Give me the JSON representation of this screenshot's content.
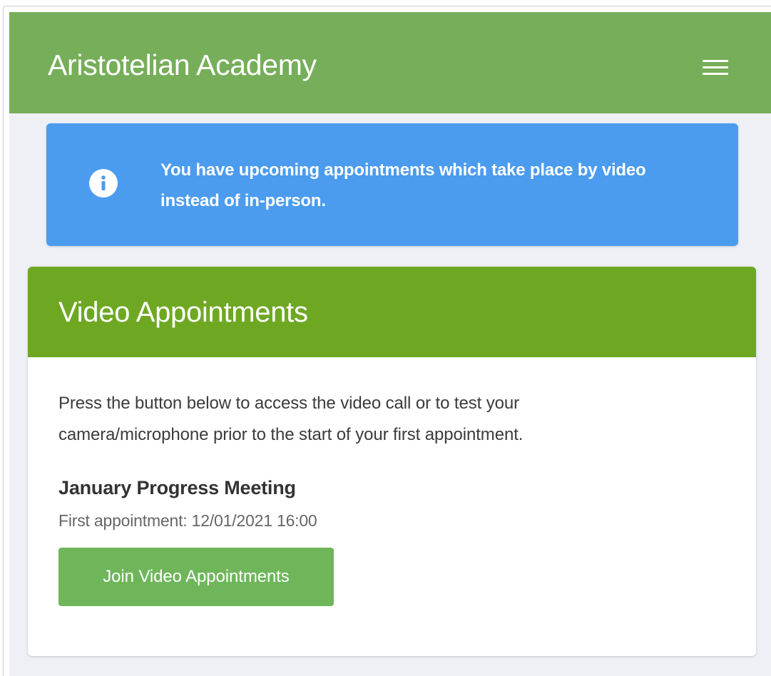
{
  "header": {
    "brand": "Aristotelian Academy",
    "menu_icon": "hamburger-menu-icon",
    "color": "#76ae59"
  },
  "alert": {
    "icon": "info-circle-icon",
    "text": "You have upcoming appointments which take place by video instead of in-person.",
    "color": "#4b9cee"
  },
  "video_card": {
    "title": "Video Appointments",
    "header_color": "#6ea823",
    "description": "Press the button below to access the video call or to test your camera/microphone prior to the start of your first appointment.",
    "meeting_title": "January Progress Meeting",
    "first_appointment": "First appointment: 12/01/2021 16:00",
    "join_button_label": "Join Video Appointments",
    "button_color": "#6fb65b"
  }
}
